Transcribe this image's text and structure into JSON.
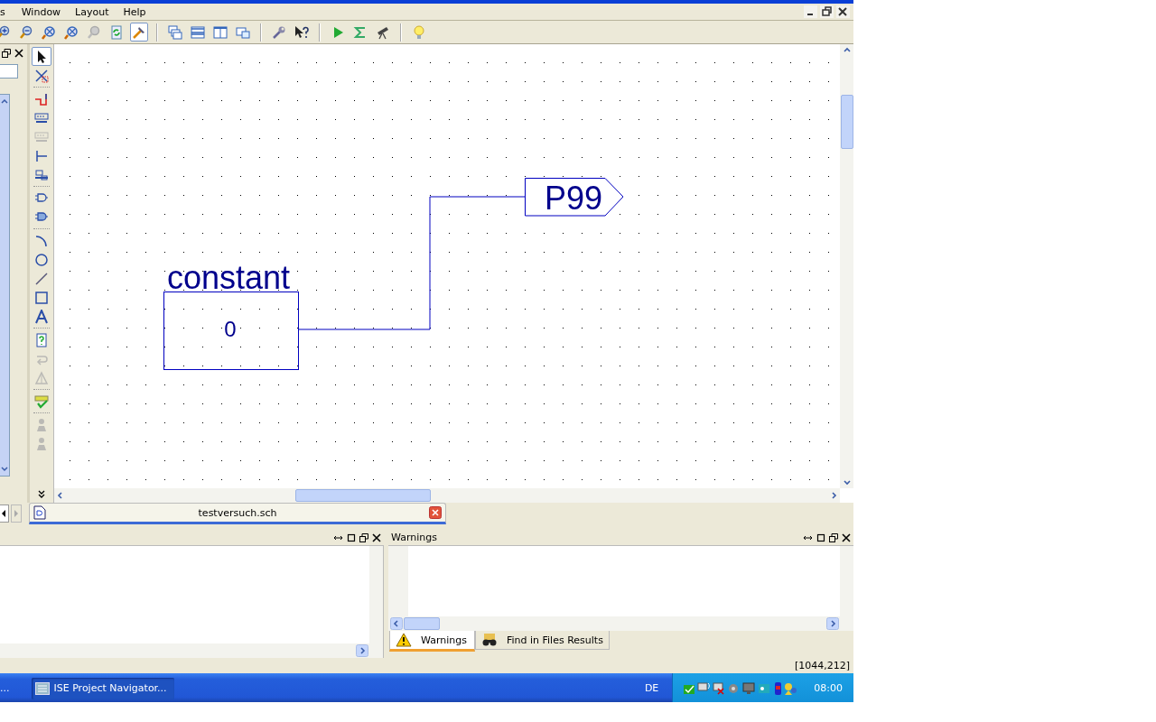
{
  "menu": [
    "s",
    "Window",
    "Layout",
    "Help"
  ],
  "toolbar_groups": [
    [
      {
        "pressed": false
      },
      {
        "pressed": false
      },
      {
        "pressed": false
      },
      {
        "pressed": false
      },
      {
        "pressed": false
      },
      {
        "pressed": false
      },
      {
        "pressed": true
      }
    ],
    [
      {
        "pressed": false
      },
      {
        "pressed": false
      },
      {
        "pressed": false
      },
      {
        "pressed": false
      }
    ],
    [
      {
        "pressed": false
      },
      {
        "pressed": false
      }
    ],
    [
      {
        "pressed": false
      },
      {
        "pressed": false
      },
      {
        "pressed": false
      }
    ],
    [
      {
        "pressed": false
      }
    ]
  ],
  "palette": [
    {
      "selected": true,
      "disabled": false
    },
    {
      "selected": false,
      "disabled": false
    },
    {
      "selected": false,
      "disabled": false
    },
    {
      "selected": false,
      "disabled": false
    },
    {
      "selected": false,
      "disabled": true
    },
    {
      "selected": false,
      "disabled": false
    },
    {
      "selected": false,
      "disabled": false
    },
    {
      "selected": false,
      "disabled": false
    },
    {
      "selected": false,
      "disabled": false
    },
    {
      "selected": false,
      "disabled": false
    },
    {
      "selected": false,
      "disabled": false
    },
    {
      "selected": false,
      "disabled": false
    },
    {
      "selected": false,
      "disabled": false
    },
    {
      "selected": false,
      "disabled": false
    },
    {
      "selected": false,
      "disabled": false
    },
    {
      "selected": false,
      "disabled": true
    },
    {
      "selected": false,
      "disabled": true
    },
    {
      "selected": false,
      "disabled": false
    },
    {
      "selected": false,
      "disabled": true
    },
    {
      "selected": false,
      "disabled": true
    }
  ],
  "schematic": {
    "symbol_name": "constant",
    "symbol_value": "0",
    "port_name": "P99"
  },
  "document_tabs": [
    {
      "label": "testversuch.sch",
      "selected": true
    }
  ],
  "warnings_panel": {
    "title": "Warnings"
  },
  "bottom_tabs": [
    {
      "label": "Warnings",
      "selected": true
    },
    {
      "label": "Find in Files Results",
      "selected": false
    }
  ],
  "status_bar": {
    "coordinates": "[1044,212]"
  },
  "taskbar": {
    "start_fragment": "...",
    "task": "ISE Project Navigator...",
    "language": "DE",
    "clock": "08:00"
  }
}
